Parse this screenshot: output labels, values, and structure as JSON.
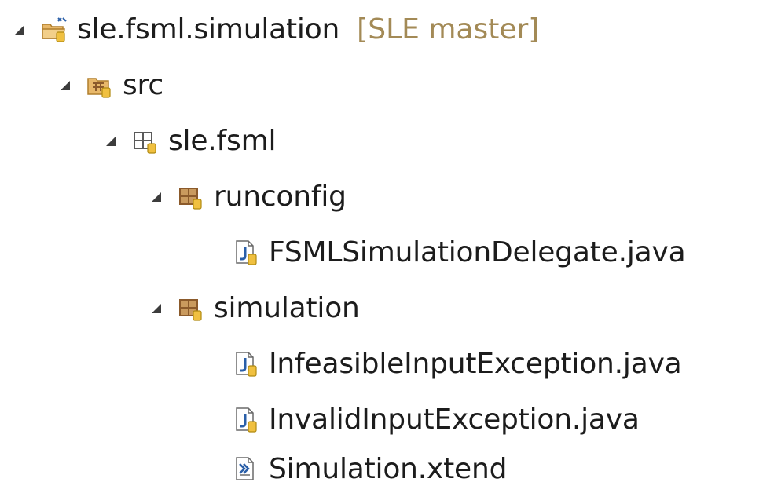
{
  "tree": {
    "project": {
      "label": "sle.fsml.simulation",
      "decorator": "[SLE master]",
      "icon": "java-project-icon"
    },
    "src_folder": {
      "label": "src",
      "icon": "source-folder-icon"
    },
    "pkg_root": {
      "label": "sle.fsml",
      "icon": "package-icon"
    },
    "pkg_runconfig": {
      "label": "runconfig",
      "icon": "package-icon",
      "files": [
        {
          "label": "FSMLSimulationDelegate.java",
          "icon": "java-file-icon"
        }
      ]
    },
    "pkg_simulation": {
      "label": "simulation",
      "icon": "package-icon",
      "files": [
        {
          "label": "InfeasibleInputException.java",
          "icon": "java-file-icon"
        },
        {
          "label": "InvalidInputException.java",
          "icon": "java-file-icon"
        },
        {
          "label": "Simulation.xtend",
          "icon": "xtend-file-icon"
        }
      ]
    }
  },
  "colors": {
    "text": "#1c1c1c",
    "decorator": "#a38a56",
    "twisty": "#3c3c3c",
    "folder": "#e8b86a",
    "package_brown": "#8b5a2b",
    "jar_yellow": "#f0c040",
    "java_blue": "#2a5fa8"
  }
}
